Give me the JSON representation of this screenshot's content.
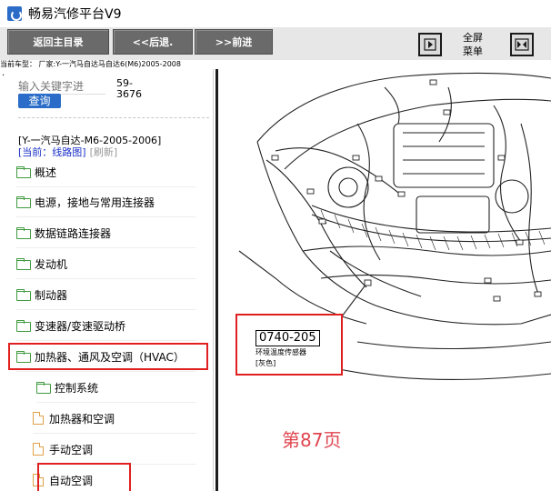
{
  "window": {
    "title": "畅易汽修平台V9"
  },
  "toolbar": {
    "home_label": "返回主目录",
    "back_label": "<<后退.",
    "forward_label": ">>前进",
    "fullscreen_label": "全屏\n菜单"
  },
  "car_info": "当前车型： 厂家:Y-一汽马自达马自达6(M6)2005-2008",
  "search": {
    "placeholder": "输入关键字进",
    "code": "59-\n3676",
    "query_label": "查询"
  },
  "model_title": "[Y-一汽马自达-M6-2005-2006]",
  "breadcrumb": {
    "current": "[当前：线路图]",
    "refresh": "[刷新]"
  },
  "tree": {
    "items": [
      {
        "label": "概述"
      },
      {
        "label": "电源，接地与常用连接器"
      },
      {
        "label": "数据链路连接器"
      },
      {
        "label": "发动机"
      },
      {
        "label": "制动器"
      },
      {
        "label": "变速器/变速驱动桥"
      },
      {
        "label": "加热器、通风及空调（HVAC）"
      }
    ],
    "subitems": [
      {
        "label": "控制系统"
      },
      {
        "label": "加热器和空调"
      },
      {
        "label": "手动空调"
      },
      {
        "label": "自动空调"
      }
    ]
  },
  "diagram": {
    "part_code": "0740-205",
    "part_name": "环境温度传感器",
    "part_color": "[灰色]",
    "page_number": "第87页"
  },
  "colors": {
    "highlight": "#e02020",
    "button_bg": "#6a6a6a",
    "query_button": "#2a6cc7",
    "folder": "#3f9a3f",
    "page_number": "#e0454f"
  }
}
